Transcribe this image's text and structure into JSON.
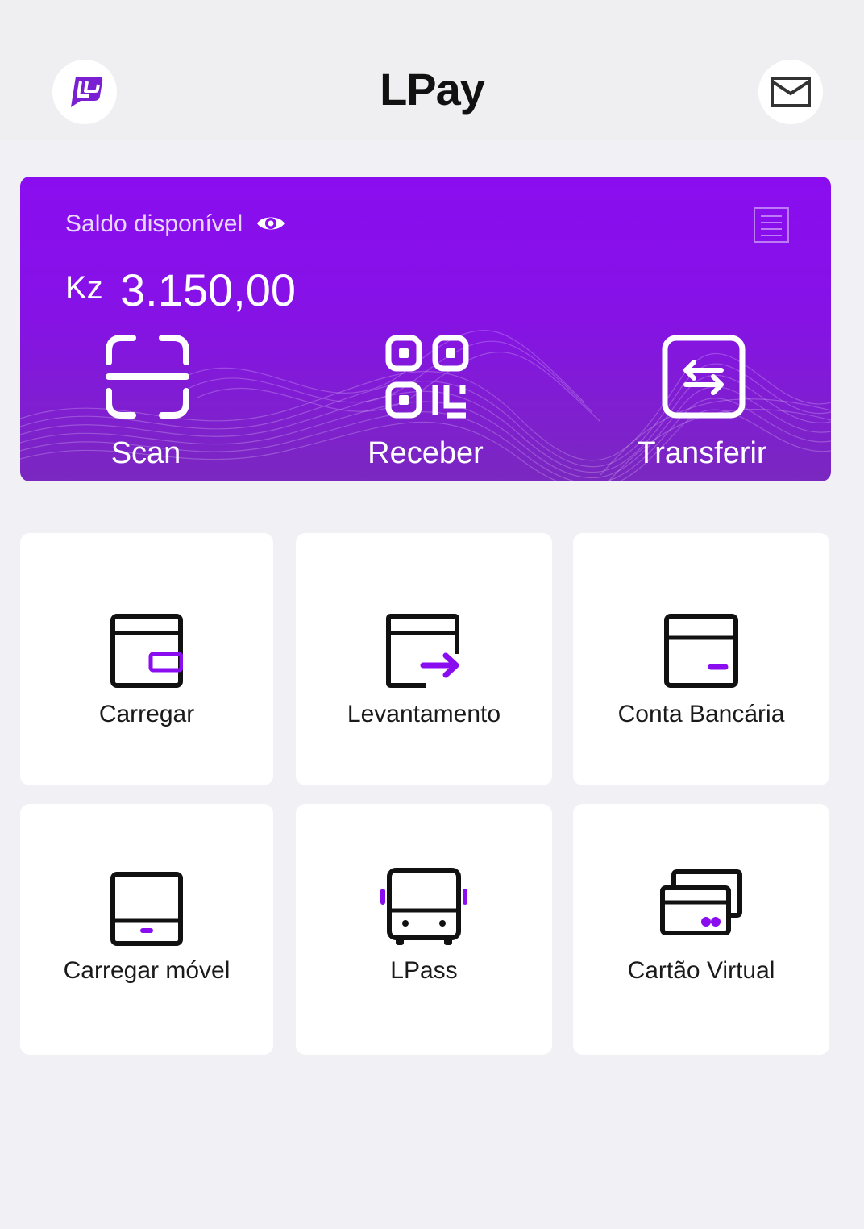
{
  "header": {
    "title": "LPay",
    "logo_icon": "lpay-logo-icon",
    "mail_icon": "mail-icon"
  },
  "balance": {
    "label": "Saldo disponível",
    "currency": "Kz",
    "amount": "3.150,00",
    "eye_icon": "eye-icon",
    "receipt_icon": "receipt-icon"
  },
  "actions": [
    {
      "label": "Scan",
      "icon": "scan-icon"
    },
    {
      "label": "Receber",
      "icon": "qr-code-icon"
    },
    {
      "label": "Transferir",
      "icon": "transfer-icon"
    }
  ],
  "services": [
    {
      "label": "Carregar",
      "icon": "wallet-icon"
    },
    {
      "label": "Levantamento",
      "icon": "withdraw-icon"
    },
    {
      "label": "Conta Bancária",
      "icon": "bank-account-icon"
    },
    {
      "label": "Carregar móvel",
      "icon": "mobile-topup-icon"
    },
    {
      "label": "LPass",
      "icon": "bus-icon"
    },
    {
      "label": "Cartão Virtual",
      "icon": "virtual-card-icon"
    }
  ],
  "colors": {
    "accent": "#8a0df0",
    "accent_dark": "#7a28c0",
    "background": "#f1f0f5",
    "header_bg": "#efeef0",
    "icon_stroke": "#111111"
  }
}
